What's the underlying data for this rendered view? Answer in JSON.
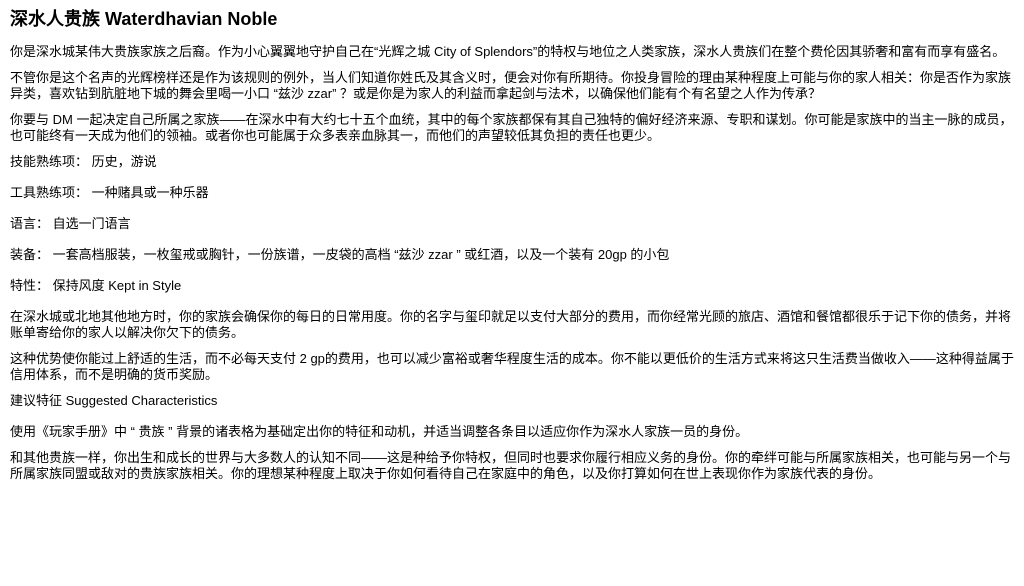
{
  "page": {
    "title_cn": "深水人贵族",
    "title_en": "Waterdhavian Noble",
    "paragraphs": [
      "你是深水城某伟大贵族家族之后裔。作为小心翼翼地守护自己在“光辉之城 City of Splendors”的特权与地位之人类家族，深水人贵族们在整个费伦因其骄奢和富有而享有盛名。",
      "不管你是这个名声的光辉榜样还是作为该规则的例外，当人们知道你姓氏及其含义时，便会对你有所期待。你投身冒险的理由某种程度上可能与你的家人相关：你是否作为家族异类，喜欢钻到肮脏地下城的舞会里喝一小口 “兹沙 zzar” ？或是你是为家人的利益而拿起剑与法术，以确保他们能有个有名望之人作为传承？",
      "你要与 DM 一起决定自己所属之家族——在深水中有大约七十五个血统，其中的每个家族都保有其自己独特的偏好经济来源、专职和谋划。你可能是家族中的当主一脉的成员，也可能终有一天成为他们的领袖。或者你也可能属于众多表亲血脉其一，而他们的声望较低其负担的责任也更少。"
    ],
    "skills": "技能熟练项： 历史，游说",
    "tools": "工具熟练项： 一种赌具或一种乐器",
    "languages": "语言： 自选一门语言",
    "equipment": "装备： 一套高档服装，一枚玺戒或胸针，一份族谱，一皮袋的高档 “兹沙 zzar ” 或红酒，以及一个装有 20gp 的小包",
    "feature": "特性： 保持风度 Kept in Style",
    "feature_paragraphs": [
      "在深水城或北地其他地方时，你的家族会确保你的每日的日常用度。你的名字与玺印就足以支付大部分的费用，而你经常光顾的旅店、酒馆和餐馆都很乐于记下你的债务，并将账单寄给你的家人以解决你欠下的债务。",
      "这种优势使你能过上舒适的生活，而不必每天支付 2 gp的费用，也可以减少富裕或奢华程度生活的成本。你不能以更低价的生活方式来将这只生活费当做收入——这种得益属于信用体系，而不是明确的货币奖励。"
    ],
    "suggested": "建议特征 Suggested Characteristics",
    "suggested_paragraphs": [
      "使用《玩家手册》中 “ 贵族 ” 背景的诸表格为基础定出你的特征和动机，并适当调整各条目以适应你作为深水人家族一员的身份。",
      "和其他贵族一样，你出生和成长的世界与大多数人的认知不同——这是种给予你特权，但同时也要求你履行相应义务的身份。你的牵绊可能与所属家族相关，也可能与另一个与所属家族同盟或敌对的贵族家族相关。你的理想某种程度上取决于你如何看待自己在家庭中的角色，以及你打算如何在世上表现你作为家族代表的身份。"
    ]
  }
}
